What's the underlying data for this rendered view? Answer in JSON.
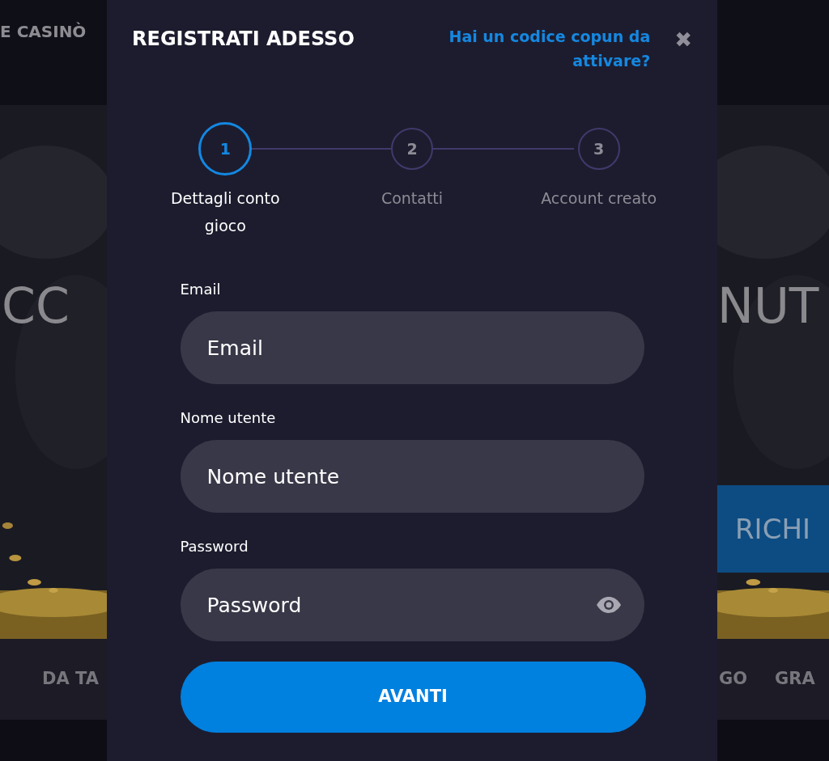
{
  "background": {
    "left": {
      "nav_item": "E CASINÒ",
      "hero_text": "CC",
      "bottom_nav_item": "DA TA"
    },
    "right": {
      "hero_text": "NUT",
      "hero_button": "RICHI",
      "bottom_nav_items": [
        "GO",
        "GRA"
      ]
    }
  },
  "modal": {
    "title": "REGISTRATI ADESSO",
    "coupon_link": "Hai un codice copun da attivare?",
    "close": "✖",
    "steps": [
      {
        "number": "1",
        "label": "Dettagli conto gioco",
        "selected": true
      },
      {
        "number": "2",
        "label": "Contatti",
        "selected": false
      },
      {
        "number": "3",
        "label": "Account creato",
        "selected": false
      }
    ],
    "fields": [
      {
        "kind": "text",
        "label": "Email",
        "placeholder": "Email"
      },
      {
        "kind": "text",
        "label": "Nome utente",
        "placeholder": "Nome utente"
      },
      {
        "kind": "password",
        "label": "Password",
        "placeholder": "Password"
      }
    ],
    "submit": "AVANTI"
  }
}
